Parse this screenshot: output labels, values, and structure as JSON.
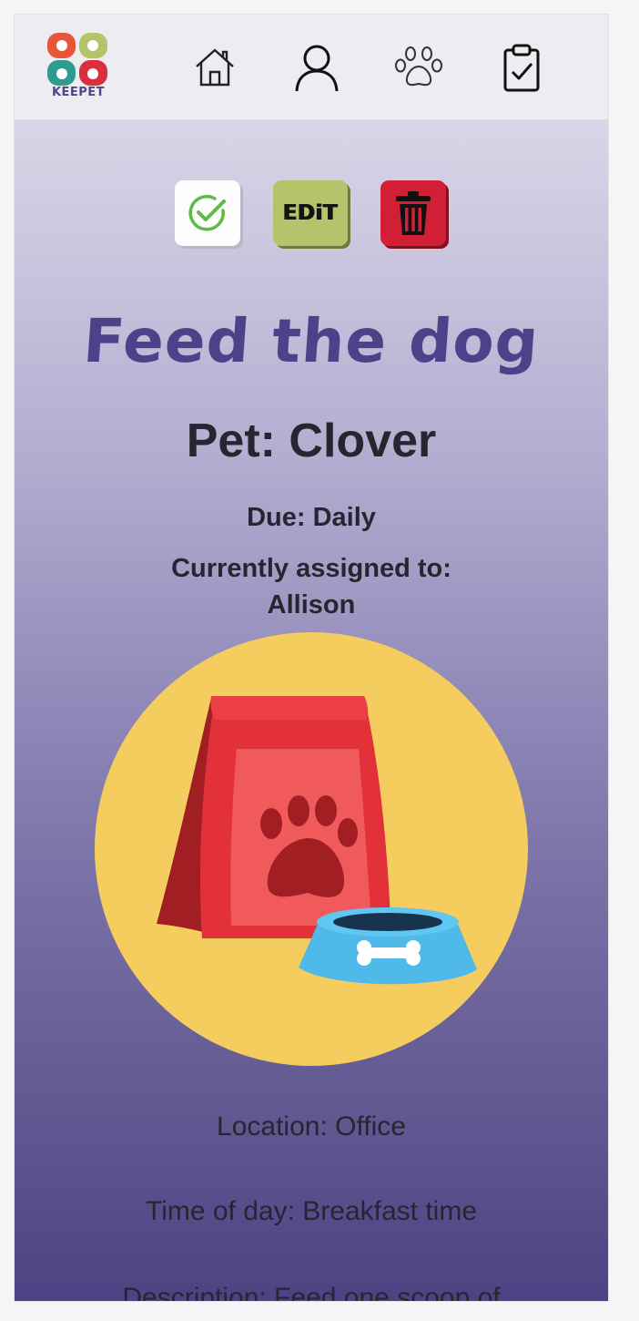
{
  "app": {
    "logo_text": "KEEPET"
  },
  "nav": {
    "items": [
      {
        "icon": "home-icon"
      },
      {
        "icon": "user-icon"
      },
      {
        "icon": "paw-icon"
      },
      {
        "icon": "clipboard-check-icon"
      }
    ]
  },
  "actions": {
    "complete_icon": "check-circle-icon",
    "edit_label": "EDiT",
    "delete_icon": "trash-icon"
  },
  "task": {
    "title": "Feed the dog",
    "pet": "Pet: Clover",
    "due": "Due: Daily",
    "assigned_label": "Currently assigned to:",
    "assigned_name": "Allison",
    "location": "Location: Office",
    "time_of_day": "Time of day: Breakfast time",
    "description": "Description: Feed one scoop of"
  },
  "colors": {
    "accent": "#4d4289",
    "edit_button": "#b3c46a",
    "delete_button": "#d11f36",
    "illustration_circle": "#f5cd5f"
  }
}
